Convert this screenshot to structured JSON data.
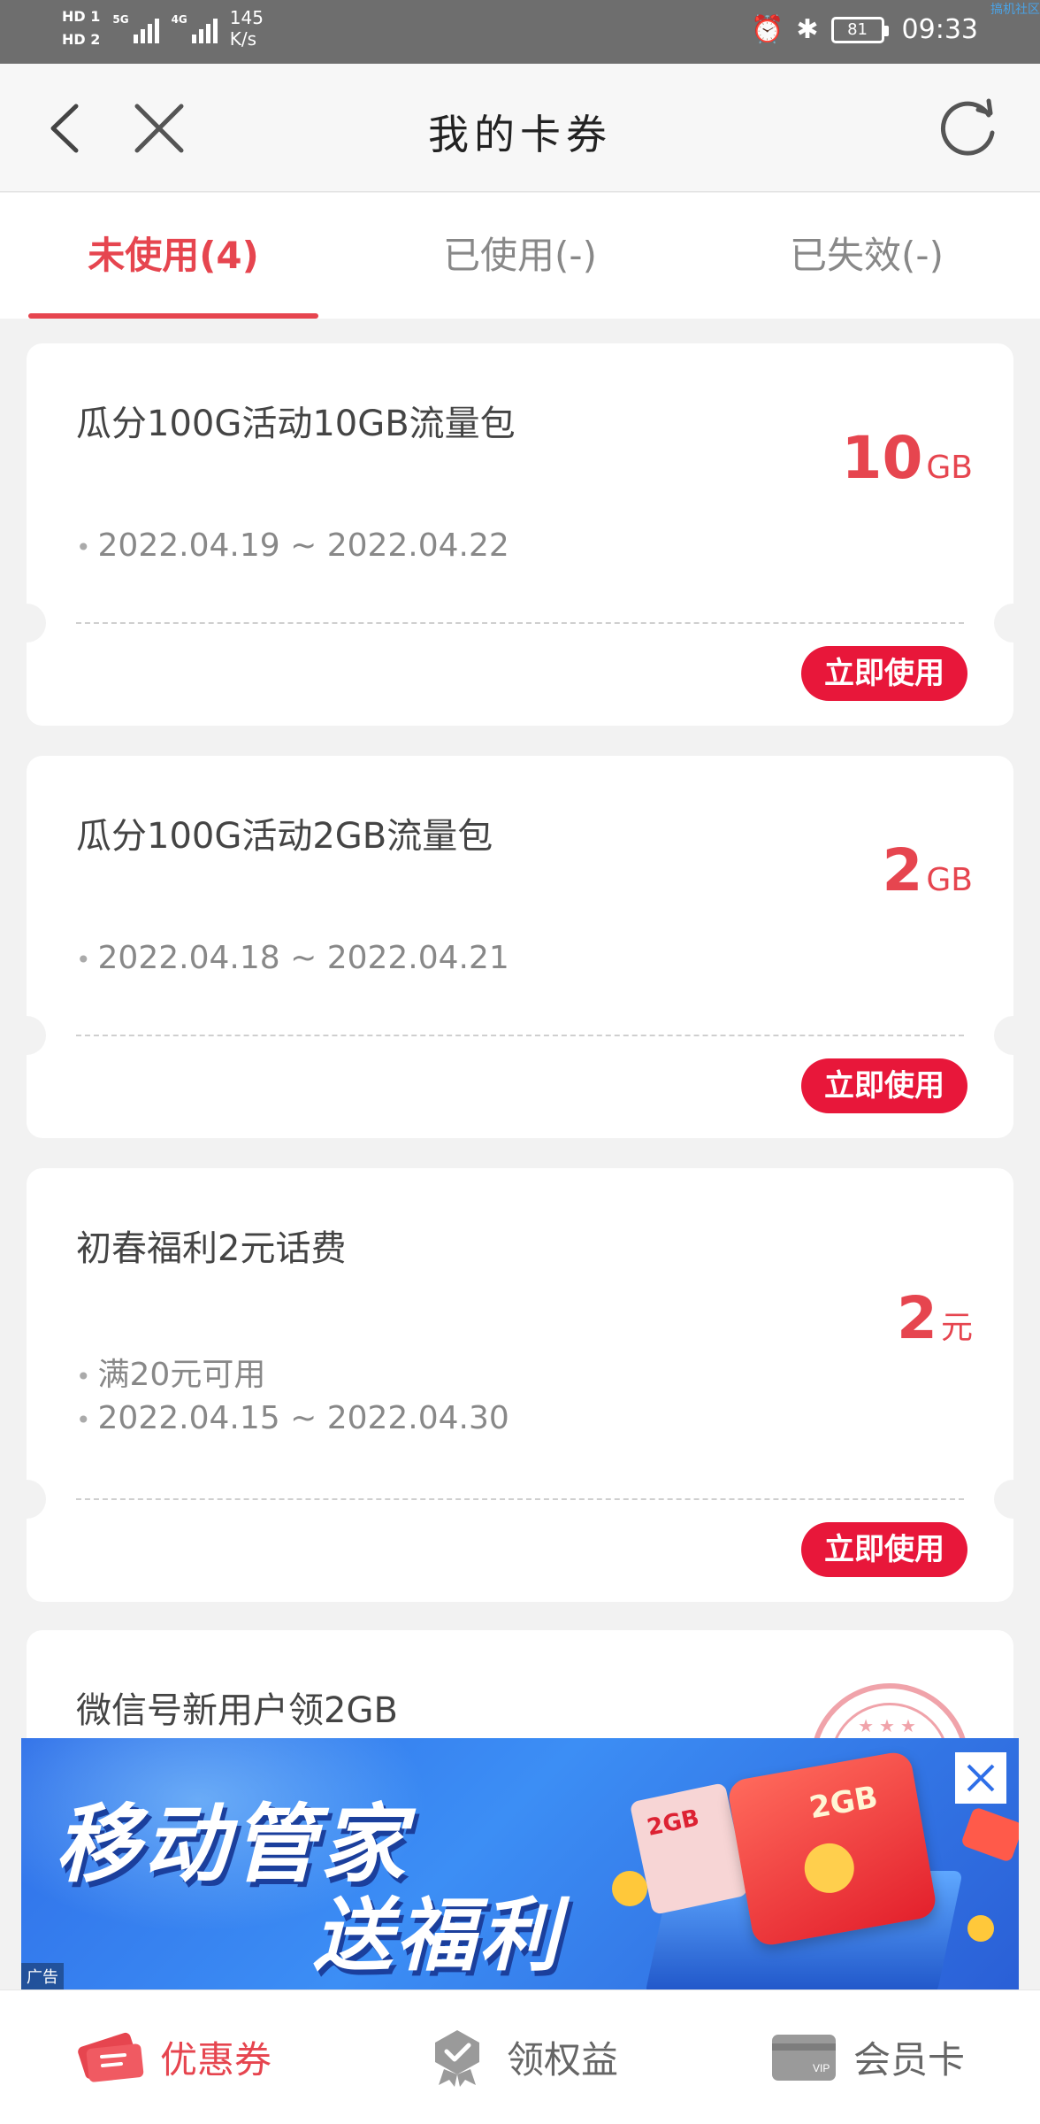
{
  "status_bar": {
    "hd1": "HD 1",
    "hd2": "HD 2",
    "net1": "5G",
    "net2": "4G",
    "speed_value": "145",
    "speed_unit": "K/s",
    "battery": "81",
    "time": "09:33",
    "watermark": "搞机社区"
  },
  "nav": {
    "title": "我的卡券"
  },
  "tabs": [
    {
      "label": "未使用(4)",
      "active": true
    },
    {
      "label": "已使用(-)",
      "active": false
    },
    {
      "label": "已失效(-)",
      "active": false
    }
  ],
  "coupons": [
    {
      "title": "瓜分100G活动10GB流量包",
      "amount": "10",
      "unit": "GB",
      "lines": [
        "2022.04.19 ~ 2022.04.22"
      ],
      "button": "立即使用"
    },
    {
      "title": "瓜分100G活动2GB流量包",
      "amount": "2",
      "unit": "GB",
      "lines": [
        "2022.04.18 ~ 2022.04.21"
      ],
      "button": "立即使用"
    },
    {
      "title": "初春福利2元话费",
      "amount": "2",
      "unit": "元",
      "lines": [
        "满20元可用",
        "2022.04.15 ~ 2022.04.30"
      ],
      "button": "立即使用"
    },
    {
      "title": "微信号新用户领2GB"
    }
  ],
  "ad": {
    "line1": "移动管家",
    "line2": "送福利",
    "envelope_text": "2GB",
    "ticket_text": "2GB",
    "tag": "广告"
  },
  "bottom_nav": [
    {
      "label": "优惠券",
      "icon": "coupon-icon",
      "active": true
    },
    {
      "label": "领权益",
      "icon": "badge-icon",
      "active": false
    },
    {
      "label": "会员卡",
      "icon": "member-card-icon",
      "active": false
    }
  ],
  "colors": {
    "accent": "#e6454f",
    "button": "#e8173a",
    "ad_blue": "#3c8ef5"
  }
}
